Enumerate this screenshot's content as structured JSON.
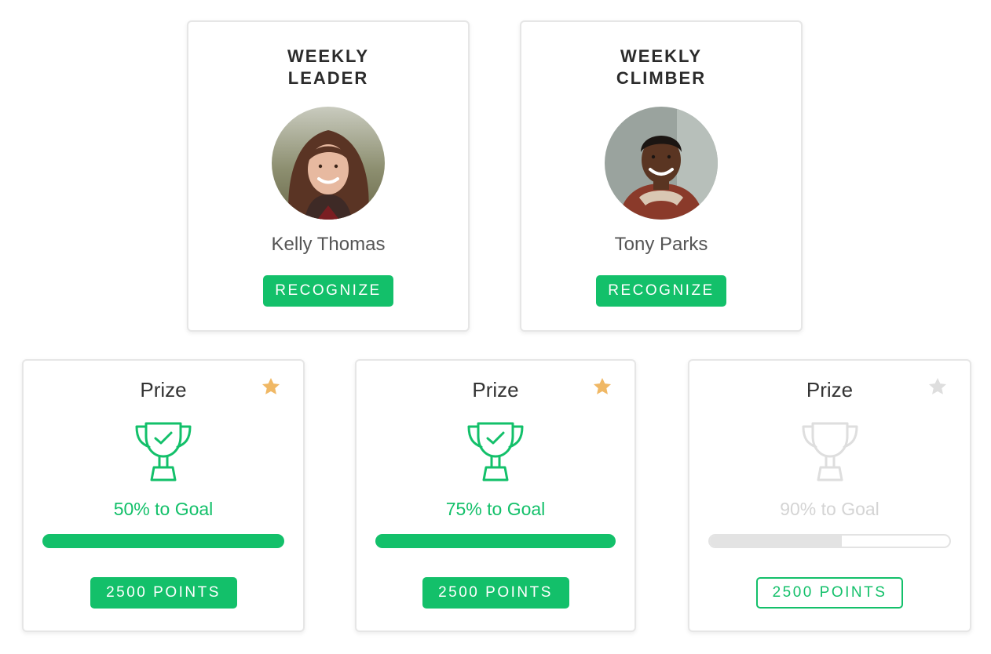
{
  "leaders": [
    {
      "title_line1": "WEEKLY",
      "title_line2": "LEADER",
      "name": "Kelly Thomas",
      "button_label": "RECOGNIZE"
    },
    {
      "title_line1": "WEEKLY",
      "title_line2": "CLIMBER",
      "name": "Tony Parks",
      "button_label": "RECOGNIZE"
    }
  ],
  "prizes": [
    {
      "title": "Prize",
      "goal_text": "50% to Goal",
      "progress": 1.0,
      "points_label": "2500 POINTS",
      "starred": true,
      "star_color": "#f0b865",
      "trophy_color": "#13c06a"
    },
    {
      "title": "Prize",
      "goal_text": "75% to Goal",
      "progress": 1.0,
      "points_label": "2500 POINTS",
      "starred": true,
      "star_color": "#f0b865",
      "trophy_color": "#13c06a"
    },
    {
      "title": "Prize",
      "goal_text": "90% to Goal",
      "progress": 0.55,
      "points_label": "2500 POINTS",
      "starred": false,
      "star_color": "#dedede",
      "trophy_color": "#dedede"
    }
  ],
  "colors": {
    "accent_green": "#13c06a",
    "star_gold": "#f0b865",
    "disabled_gray": "#dedede"
  },
  "icons": {
    "star": "star-icon",
    "trophy": "trophy-icon"
  }
}
